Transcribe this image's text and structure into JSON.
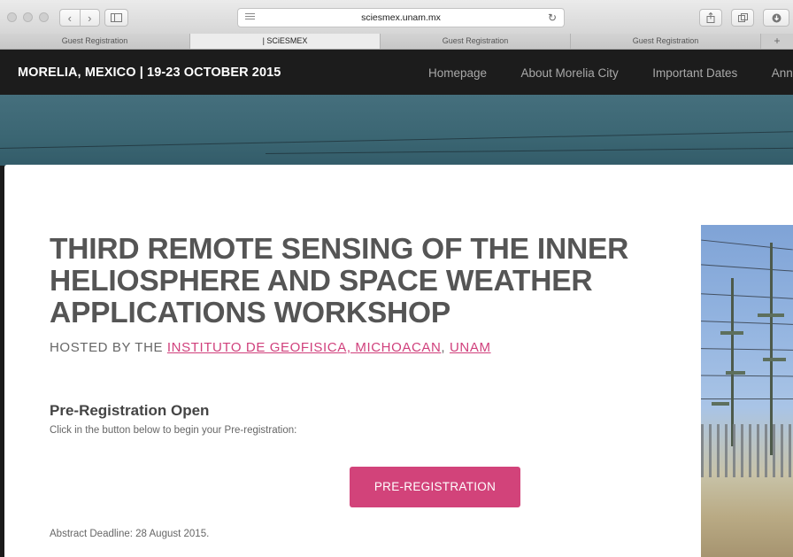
{
  "browser": {
    "url": "sciesmex.unam.mx",
    "tabs": [
      {
        "label": "Guest Registration",
        "active": false
      },
      {
        "label": "| SCiESMEX",
        "active": true
      },
      {
        "label": "Guest Registration",
        "active": false
      },
      {
        "label": "Guest Registration",
        "active": false
      }
    ],
    "new_tab_symbol": "+"
  },
  "site": {
    "title": "MORELIA, MEXICO | 19-23 OCTOBER 2015",
    "nav": [
      "Homepage",
      "About Morelia City",
      "Important Dates",
      "Anno"
    ]
  },
  "content": {
    "heading": "THIRD REMOTE SENSING OF THE INNER HELIOSPHERE AND SPACE WEATHER APPLICATIONS WORKSHOP",
    "hosted_prefix": "HOSTED BY THE ",
    "hosted_link1": "INSTITUTO DE GEOFISICA, MICHOACAN",
    "hosted_sep": ", ",
    "hosted_link2": "UNAM",
    "prereg_title": "Pre-Registration Open",
    "prereg_text": "Click in the button below to begin your Pre-registration:",
    "prereg_button": "PRE-REGISTRATION",
    "deadline": "Abstract Deadline: 28 August 2015."
  },
  "colors": {
    "accent": "#d2437a",
    "link": "#d0407c",
    "header_bg": "#1c1c1c"
  },
  "icons": [
    "back-icon",
    "forward-icon",
    "sidebar-icon",
    "reader-icon",
    "reload-icon",
    "share-icon",
    "tabs-icon",
    "download-icon"
  ]
}
